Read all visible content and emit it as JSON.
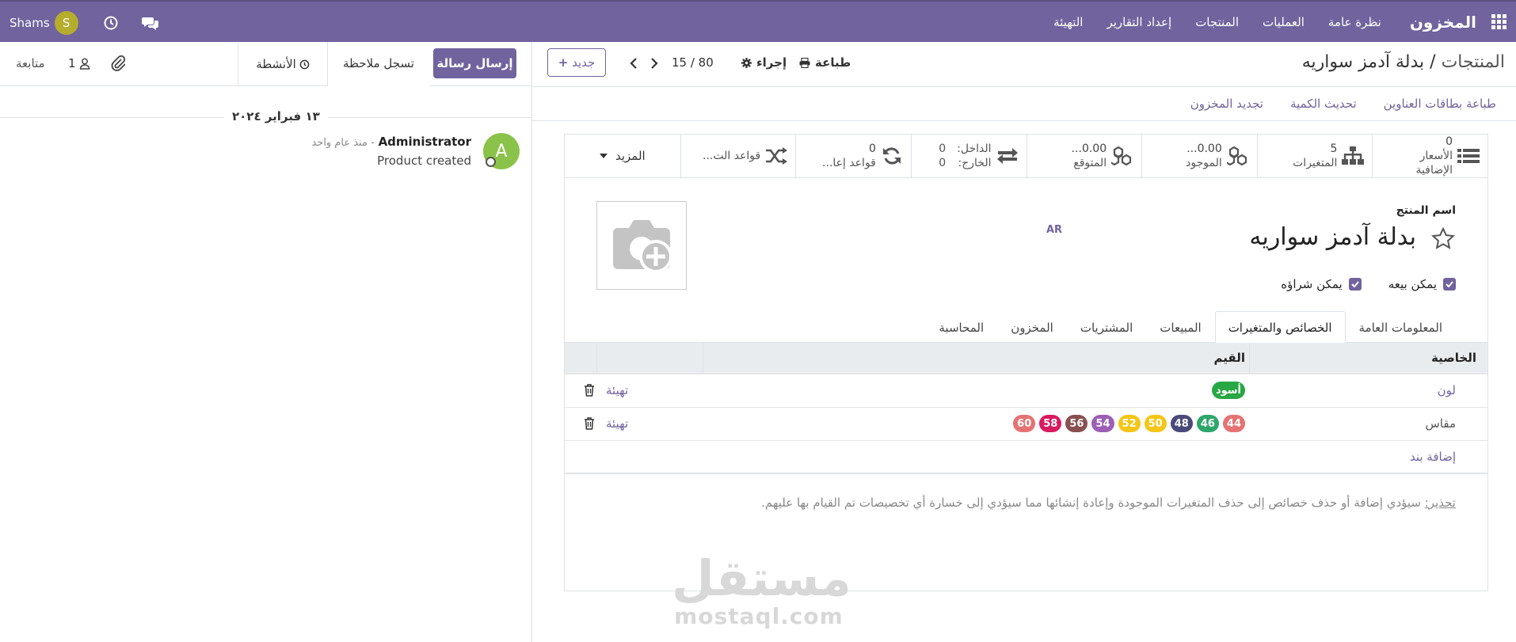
{
  "navbar": {
    "app_title": "المخزون",
    "menu": [
      "نظرة عامة",
      "العمليات",
      "المنتجات",
      "إعداد التقارير",
      "التهيئة"
    ],
    "user_name": "Shams",
    "user_initial": "S",
    "bg_color": "#71639e"
  },
  "chatter": {
    "send_message": "إرسال رسالة",
    "log_note": "تسجل ملاحظة",
    "activities": "الأنشطة",
    "followers_count": "1",
    "follow": "متابعة",
    "date_separator": "١٣ فبراير ٢٠٢٤",
    "message": {
      "author": "Administrator",
      "time": "- منذ عام واحد",
      "body": "Product created",
      "initial": "A"
    }
  },
  "control_panel": {
    "breadcrumb_root": "المنتجات",
    "breadcrumb_current": "بدلة آدمز سواريه",
    "print": "طباعة",
    "action": "إجراء",
    "pager": "15 / 80",
    "new_button": "جديد"
  },
  "status_actions": [
    "طباعة بطاقات العناوين",
    "تحديث الكمية",
    "تجديد المخزون"
  ],
  "smart_buttons": {
    "extra_prices": {
      "value": "0",
      "label": "الأسعار الإضافية"
    },
    "variants": {
      "value": "5",
      "label": "المتغيرات"
    },
    "on_hand": {
      "value": "0.00...",
      "label": "الموجود"
    },
    "forecasted": {
      "value": "0.00...",
      "label": "المتوقع"
    },
    "in_out": {
      "in_label": "الداخل:",
      "in_value": "0",
      "out_label": "الخارج:",
      "out_value": "0"
    },
    "reorder_rules": {
      "value": "0",
      "label": "قواعد إعا..."
    },
    "routes": {
      "label": "قواعد الت..."
    },
    "more": "المزيد"
  },
  "form": {
    "product_name_label": "اسم المنتج",
    "product_name": "بدلة آدمز سواريه",
    "lang": "AR",
    "can_be_sold": "يمكن بيعه",
    "can_be_purchased": "يمكن شراؤه",
    "tabs": [
      "المعلومات العامة",
      "الخصائص والمتغيرات",
      "المبيعات",
      "المشتريات",
      "المخزون",
      "المحاسبة"
    ],
    "active_tab": "الخصائص والمتغيرات"
  },
  "attributes_table": {
    "col_attribute": "الخاصية",
    "col_values": "القيم",
    "rows": [
      {
        "attribute": "لون",
        "values": [
          {
            "label": "أسود",
            "color": "#28a745"
          }
        ],
        "configure": "تهيئة"
      },
      {
        "attribute": "مقاس",
        "values": [
          {
            "label": "44",
            "color": "#e57373"
          },
          {
            "label": "46",
            "color": "#2ea66b"
          },
          {
            "label": "48",
            "color": "#4a4a7a"
          },
          {
            "label": "50",
            "color": "#f5c518"
          },
          {
            "label": "52",
            "color": "#f5c518"
          },
          {
            "label": "54",
            "color": "#9c5fb5"
          },
          {
            "label": "56",
            "color": "#8a5050"
          },
          {
            "label": "58",
            "color": "#d81b60"
          },
          {
            "label": "60",
            "color": "#e57373"
          }
        ],
        "configure": "تهيئة"
      }
    ],
    "add_line": "إضافة بند"
  },
  "warning": {
    "prefix": "تحذير:",
    "text": "سيؤدي إضافة أو حذف خصائص إلى حذف المتغيرات الموجودة وإعادة إنشائها مما سيؤدي إلى خسارة أي تخصيصات تم القيام بها عليهم."
  },
  "watermark": {
    "arabic": "مستقل",
    "latin": "mostaql.com"
  }
}
